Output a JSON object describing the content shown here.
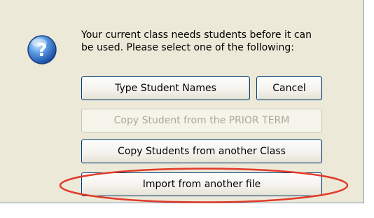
{
  "dialog": {
    "message_line1": "Your current class needs students before it can",
    "message_line2": "be used. Please select one of the following:",
    "icon": "question-mark-icon"
  },
  "buttons": {
    "type_names": "Type Student Names",
    "cancel": "Cancel",
    "copy_prior": "Copy Student from the PRIOR TERM",
    "copy_class": "Copy Students from another Class",
    "import_file": "Import from another file"
  },
  "states": {
    "copy_prior_enabled": false
  },
  "colors": {
    "dialog_bg": "#ece9d8",
    "button_border": "#003c74",
    "disabled_text": "#aca899",
    "highlight_oval": "#e23a2a"
  }
}
